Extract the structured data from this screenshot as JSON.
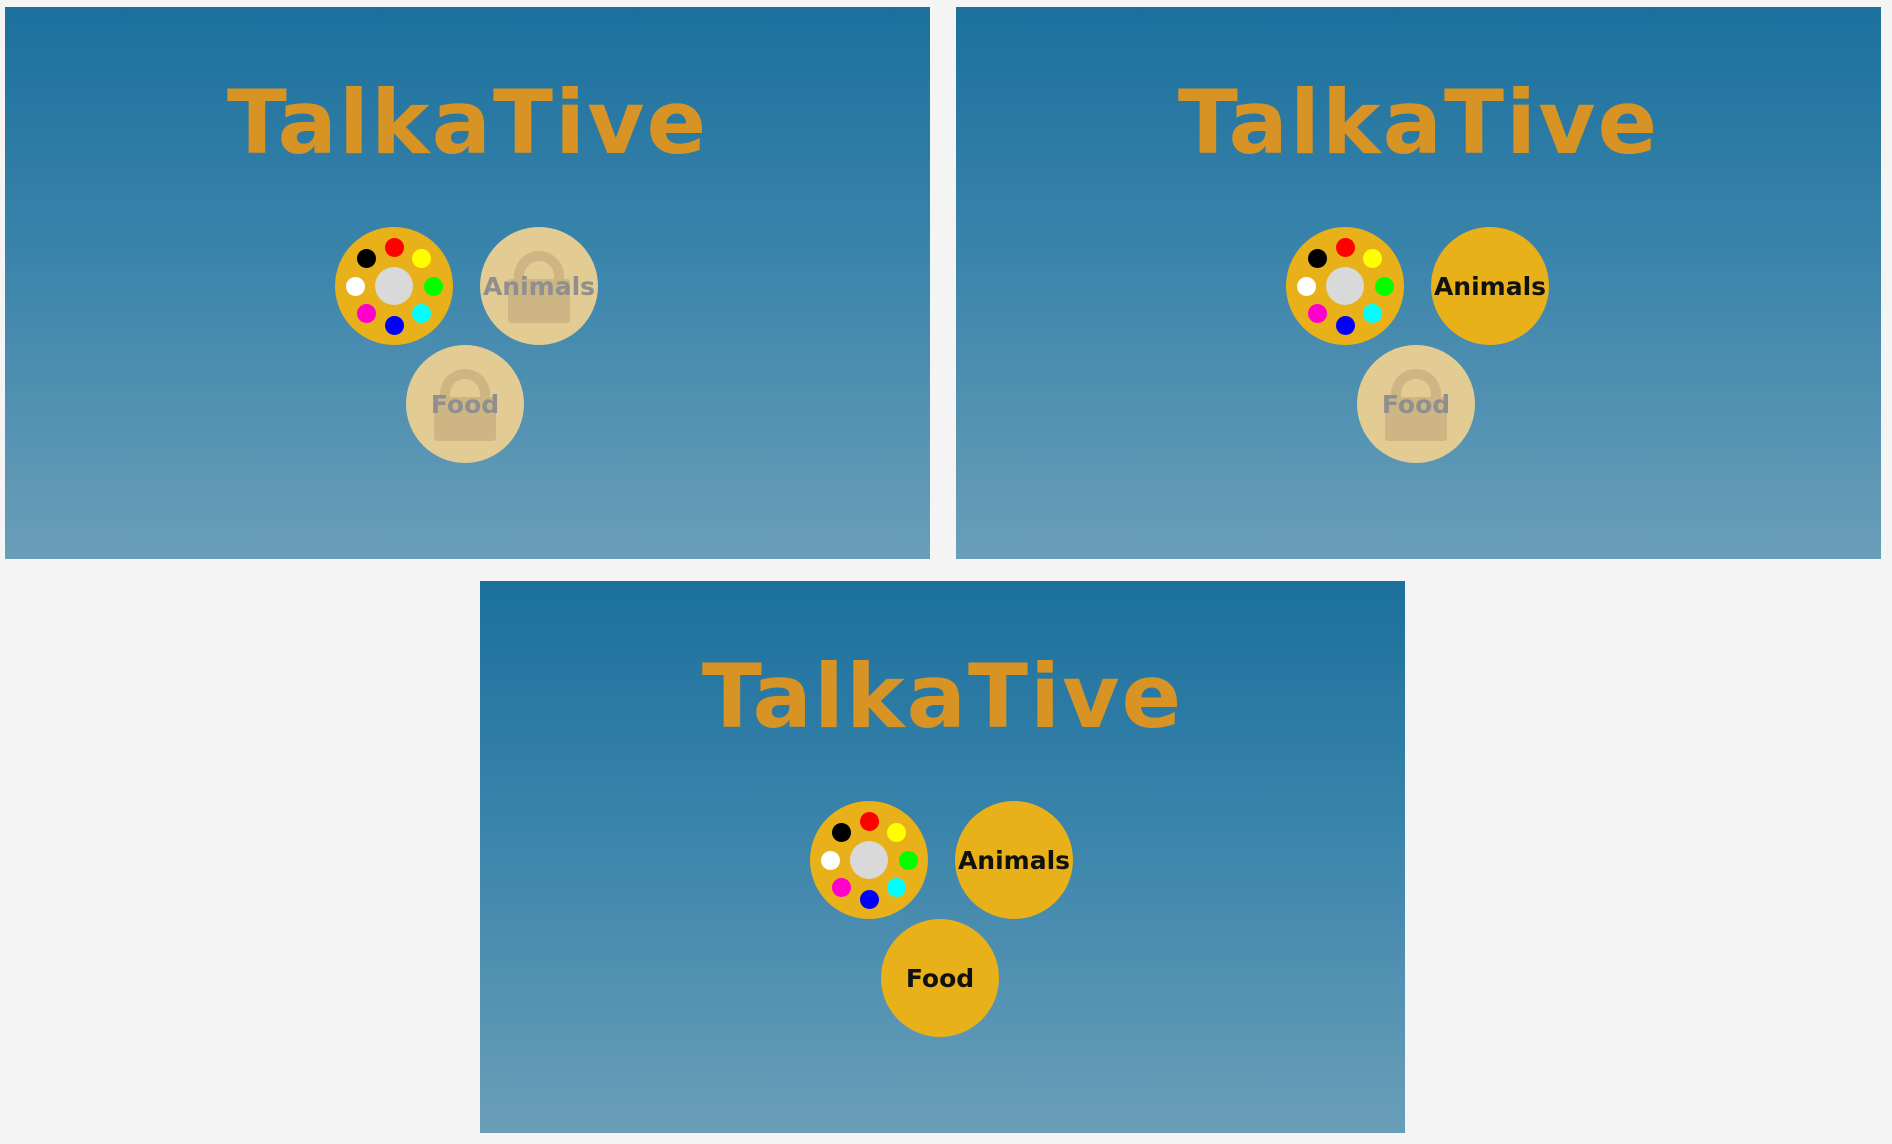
{
  "app": {
    "title": "TalkaTive"
  },
  "palette": {
    "hub_color": "#d9d9d9",
    "dots": [
      {
        "color": "#ff0000",
        "name": "red"
      },
      {
        "color": "#ffff00",
        "name": "yellow"
      },
      {
        "color": "#00ff00",
        "name": "green"
      },
      {
        "color": "#00ffff",
        "name": "cyan"
      },
      {
        "color": "#0000ff",
        "name": "blue"
      },
      {
        "color": "#ff00cc",
        "name": "magenta"
      },
      {
        "color": "#ffffff",
        "name": "white"
      },
      {
        "color": "#000000",
        "name": "black"
      }
    ]
  },
  "categories": {
    "animals": {
      "label": "Animals"
    },
    "food": {
      "label": "Food"
    }
  },
  "screens": [
    {
      "animals_locked": true,
      "food_locked": true
    },
    {
      "animals_locked": false,
      "food_locked": true
    },
    {
      "animals_locked": false,
      "food_locked": false
    }
  ],
  "colors": {
    "title": "#d89325",
    "tile": "#e8b119",
    "tile_locked": "#e3cc93",
    "lock_icon": "#cdb684",
    "label_locked": "#8f8f8f",
    "label": "#111111",
    "page_background": "#f4f4f4"
  },
  "icons": {
    "lock": "lock-icon",
    "palette": "color-palette-icon"
  }
}
